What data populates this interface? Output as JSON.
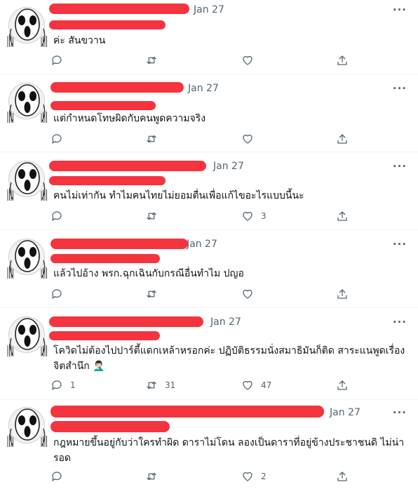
{
  "tweets": [
    {
      "date": "Jan 27",
      "text": "ค่ะ สันขวาน",
      "reply": "",
      "retweet": "",
      "like": ""
    },
    {
      "date": "Jan 27",
      "text": "แต่กำหนดโทษผิดกับคนพูดความจริง",
      "reply": "",
      "retweet": "",
      "like": ""
    },
    {
      "date": "Jan 27",
      "text": "คนไม่เท่ากัน ทำไมคนไทยไม่ยอมตื่นเพื่อแก้ไขอะไรแบบนี้นะ",
      "reply": "",
      "retweet": "",
      "like": "3"
    },
    {
      "date": "Jan 27",
      "text": "แล้วไปอ้าง พรก.ฉุกเฉินกับกรณีอื่นทำไม ปญอ",
      "reply": "",
      "retweet": "",
      "like": ""
    },
    {
      "date": "Jan 27",
      "text": "โควิดไม่ต้องไปปาร์ตี้แดกเหล้าหรอกค่ะ ปฏิบัติธรรมนั่งสมาธิมันก็ติด สาระแนพูดเรื่อง",
      "text2": "จิตสำนึก 🤦🏻‍♂️",
      "reply": "1",
      "retweet": "31",
      "like": "47"
    },
    {
      "date": "Jan 27",
      "text": "กฎหมายขึ้นอยู่กับว่าใครทำผิด ดาราไม่โดน ลองเป็นดาราที่อยู่ข้างประชาชนดิ ไม่น่า",
      "text2": "รอด",
      "reply": "",
      "retweet": "",
      "like": "2"
    }
  ],
  "icons": {
    "avatar": "scream-face-avatar",
    "more": "more-horizontal-icon",
    "reply": "reply-icon",
    "retweet": "retweet-icon",
    "like": "heart-icon",
    "share": "share-icon"
  },
  "more_label": "···",
  "colors": {
    "redaction": "#f4343f",
    "secondary": "#536471",
    "divider": "#eff3f4"
  }
}
